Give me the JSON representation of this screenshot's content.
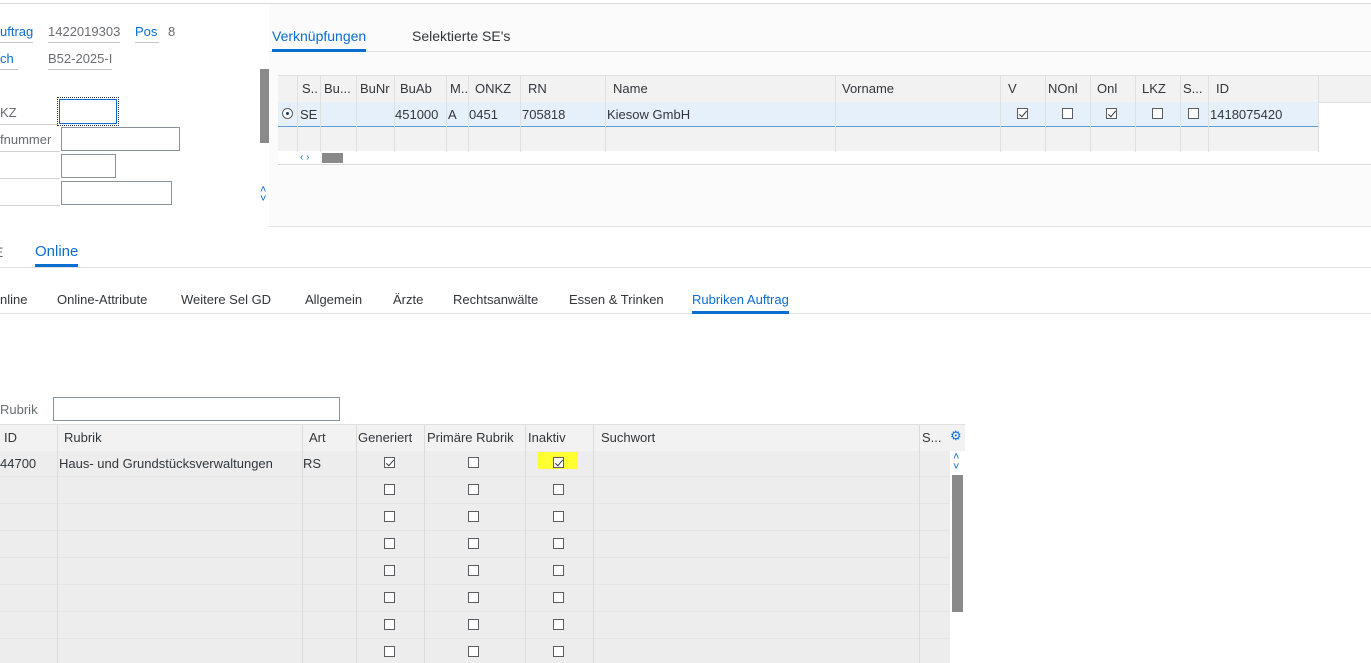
{
  "header": {
    "auftrag_label": "uftrag",
    "auftrag_value": "1422019303",
    "pos_label": "Pos",
    "pos_value": "8",
    "buch_label": "ch",
    "buch_value": "B52-2025-I",
    "kz_label": "KZ",
    "kz_value": "",
    "fnummer_label": "fnummer",
    "fnummer_value": "",
    "field3_value": "",
    "field4_value": ""
  },
  "upper_tabs": [
    {
      "label": "Verknüpfungen",
      "active": true
    },
    {
      "label": "Selektierte SE's",
      "active": false
    }
  ],
  "upper_table": {
    "columns": [
      "S..",
      "Bu...",
      "BuNr",
      "BuAb",
      "M..",
      "ONKZ",
      "RN",
      "Name",
      "Vorname",
      "V",
      "NOnl",
      "Onl",
      "LKZ",
      "S...",
      "ID"
    ],
    "rows": [
      {
        "s": "SE",
        "bu": "",
        "bunr": "",
        "buab": "451000",
        "m": "A",
        "onkz": "0451",
        "rn": "705818",
        "name": "Kiesow GmbH",
        "vorname": "",
        "v": true,
        "nonl": false,
        "onl": true,
        "lkz": false,
        "s2": false,
        "id": "1418075420"
      }
    ],
    "scroll_arrows": "‹ ›"
  },
  "main_tabs": [
    {
      "label": "E",
      "active": false
    },
    {
      "label": "Online",
      "active": true
    }
  ],
  "sub_tabs": [
    {
      "label": "nline",
      "active": false
    },
    {
      "label": "Online-Attribute",
      "active": false
    },
    {
      "label": "Weitere Sel GD",
      "active": false
    },
    {
      "label": "Allgemein",
      "active": false
    },
    {
      "label": "Ärzte",
      "active": false
    },
    {
      "label": "Rechtsanwälte",
      "active": false
    },
    {
      "label": "Essen & Trinken",
      "active": false
    },
    {
      "label": "Rubriken Auftrag",
      "active": true
    }
  ],
  "rubrik_filter": {
    "label": "Rubrik",
    "value": ""
  },
  "lower_table": {
    "columns": [
      "ID",
      "Rubrik",
      "Art",
      "Generiert",
      "Primäre Rubrik",
      "Inaktiv",
      "Suchwort",
      "S..."
    ],
    "rows": [
      {
        "id": "44700",
        "rubrik": "Haus- und Grundstücksverwaltungen",
        "art": "RS",
        "generiert": true,
        "primaer": false,
        "inaktiv": true,
        "highlight": true
      },
      {
        "id": "",
        "rubrik": "",
        "art": "",
        "generiert": false,
        "primaer": false,
        "inaktiv": false
      },
      {
        "id": "",
        "rubrik": "",
        "art": "",
        "generiert": false,
        "primaer": false,
        "inaktiv": false
      },
      {
        "id": "",
        "rubrik": "",
        "art": "",
        "generiert": false,
        "primaer": false,
        "inaktiv": false
      },
      {
        "id": "",
        "rubrik": "",
        "art": "",
        "generiert": false,
        "primaer": false,
        "inaktiv": false
      },
      {
        "id": "",
        "rubrik": "",
        "art": "",
        "generiert": false,
        "primaer": false,
        "inaktiv": false
      },
      {
        "id": "",
        "rubrik": "",
        "art": "",
        "generiert": false,
        "primaer": false,
        "inaktiv": false
      },
      {
        "id": "",
        "rubrik": "",
        "art": "",
        "generiert": false,
        "primaer": false,
        "inaktiv": false
      }
    ],
    "settings_icon": "gear-icon"
  },
  "colors": {
    "accent": "#0a6ed1",
    "highlight": "#ffff33",
    "selected_row": "#e5f0fa"
  }
}
